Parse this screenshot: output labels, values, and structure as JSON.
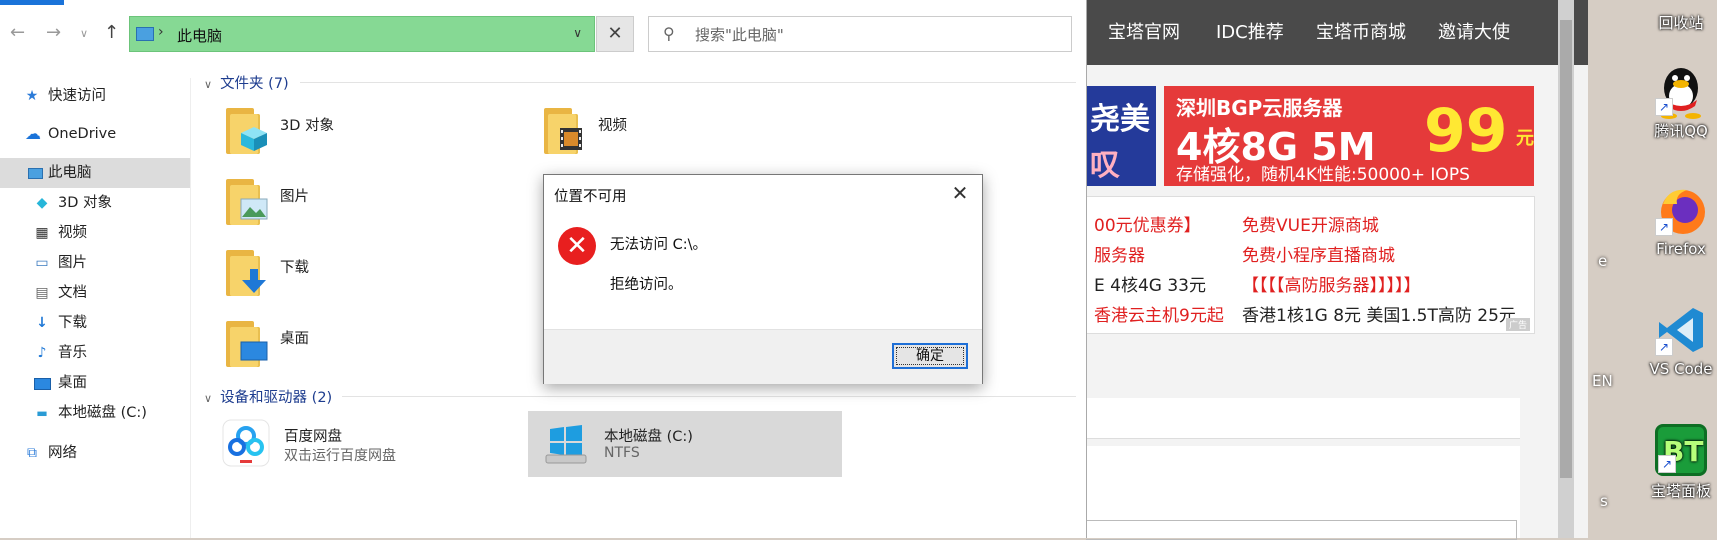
{
  "explorer": {
    "address_path": "此电脑",
    "search_placeholder": "搜索\"此电脑\"",
    "sidebar": [
      {
        "label": "快速访问",
        "icon": "star-icon"
      },
      {
        "label": "OneDrive",
        "icon": "cloud-icon"
      },
      {
        "label": "此电脑",
        "icon": "computer-icon",
        "selected": true
      },
      {
        "label": "3D 对象",
        "icon": "cube-icon"
      },
      {
        "label": "视频",
        "icon": "video-icon"
      },
      {
        "label": "图片",
        "icon": "picture-icon"
      },
      {
        "label": "文档",
        "icon": "document-icon"
      },
      {
        "label": "下载",
        "icon": "download-icon"
      },
      {
        "label": "音乐",
        "icon": "music-icon"
      },
      {
        "label": "桌面",
        "icon": "desktop-icon"
      },
      {
        "label": "本地磁盘 (C:)",
        "icon": "drive-icon"
      },
      {
        "label": "网络",
        "icon": "network-icon"
      }
    ],
    "folders_group": "文件夹 (7)",
    "folders": [
      {
        "label": "3D 对象",
        "icon": "cube-icon"
      },
      {
        "label": "视频",
        "icon": "video-icon"
      },
      {
        "label": "图片",
        "icon": "picture-icon"
      },
      {
        "label": "下载",
        "icon": "download-icon"
      },
      {
        "label": "桌面",
        "icon": "desktop-icon"
      }
    ],
    "devices_group": "设备和驱动器 (2)",
    "devices": [
      {
        "label": "百度网盘",
        "sub": "双击运行百度网盘",
        "icon": "baidu-netdisk-icon"
      },
      {
        "label": "本地磁盘 (C:)",
        "sub": "NTFS",
        "icon": "windows-drive-icon",
        "selected": true
      }
    ]
  },
  "dialog": {
    "title": "位置不可用",
    "message1": "无法访问 C:\\。",
    "message2": "拒绝访问。",
    "ok_label": "确定"
  },
  "browser": {
    "nav": [
      "宝塔官网",
      "IDC推荐",
      "宝塔币商城",
      "邀请大使"
    ],
    "ad1": {
      "line1": "尧美",
      "line2": "叹"
    },
    "ad2": {
      "title": "深圳BGP云服务器",
      "main": "4核8G 5M",
      "price": "99",
      "price_unit": "元",
      "bottom": "存储强化，随机4K性能:50000+ IOPS"
    },
    "links_left": [
      "00元优惠券】",
      "服务器",
      "E 4核4G 33元",
      "香港云主机9元起"
    ],
    "links_right": [
      "免费VUE开源商城",
      "免费小程序直播商城",
      "【【【【高防服务器】】】】】",
      "香港1核1G 8元 美国1.5T高防 25元"
    ],
    "ad_tag": "广告"
  },
  "desktop": [
    {
      "label": "回收站",
      "icon": "recycle-bin-icon"
    },
    {
      "label": "腾讯QQ",
      "icon": "qq-icon"
    },
    {
      "label": "Firefox",
      "icon": "firefox-icon"
    },
    {
      "label": "VS Code",
      "icon": "vscode-icon"
    },
    {
      "label": "宝塔面板",
      "icon": "bt-panel-icon"
    }
  ],
  "desktop_cut_labels": [
    "e",
    "EN",
    "s"
  ],
  "colors": {
    "address_bg": "#86d994",
    "dialog_error": "#e81f1f",
    "group_header": "#1e3d8f",
    "accent": "#1a73d9"
  }
}
